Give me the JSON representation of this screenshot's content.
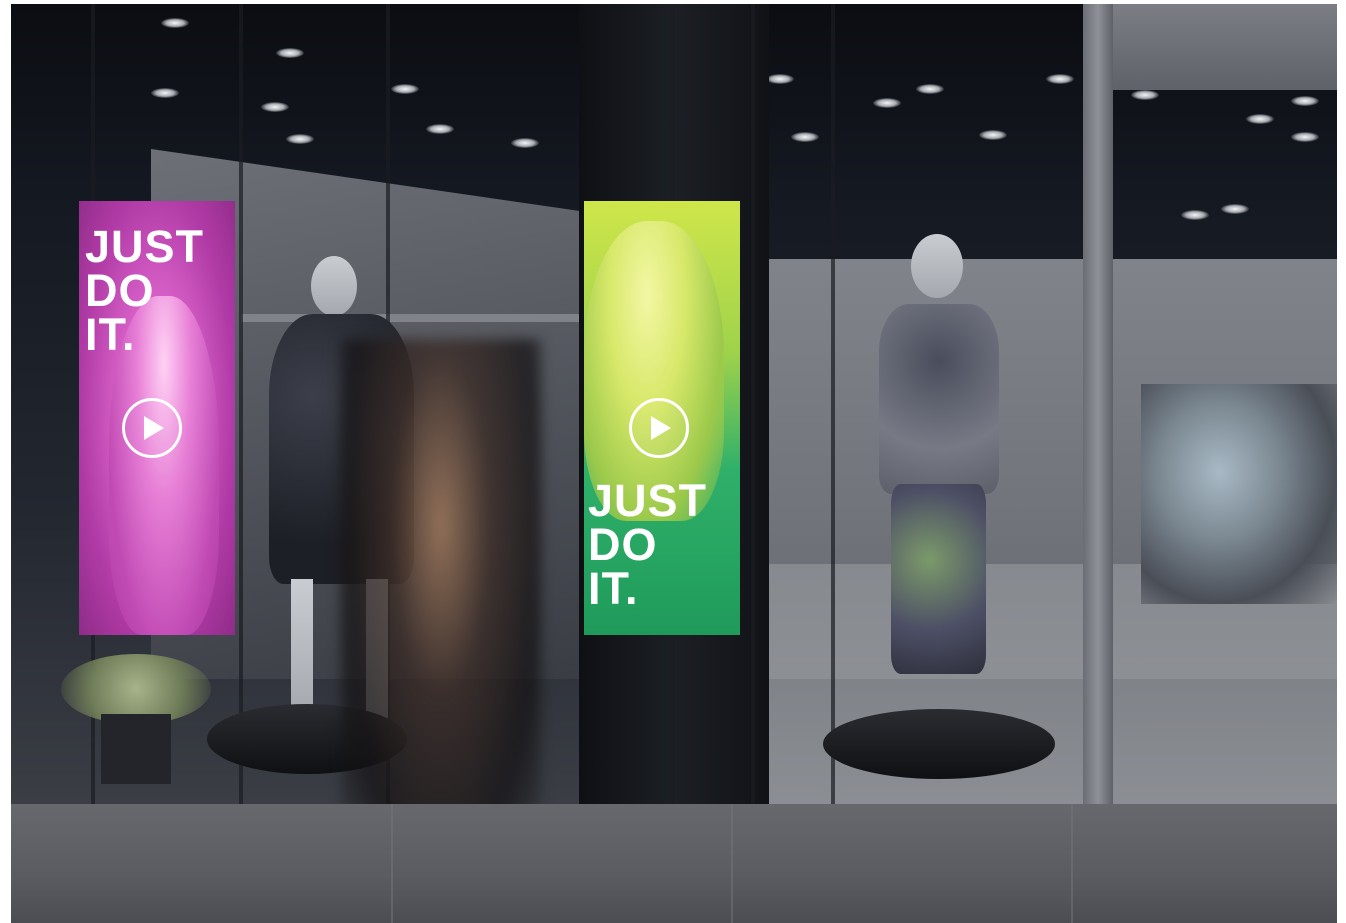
{
  "posters": [
    {
      "id": "pink",
      "slogan": [
        "JUST",
        "DO",
        "IT."
      ],
      "play_icon": "play-icon",
      "accent": "#c048b4"
    },
    {
      "id": "green",
      "slogan": [
        "JUST",
        "DO",
        "IT."
      ],
      "play_icon": "play-icon",
      "accent": "#2fb06a"
    }
  ]
}
